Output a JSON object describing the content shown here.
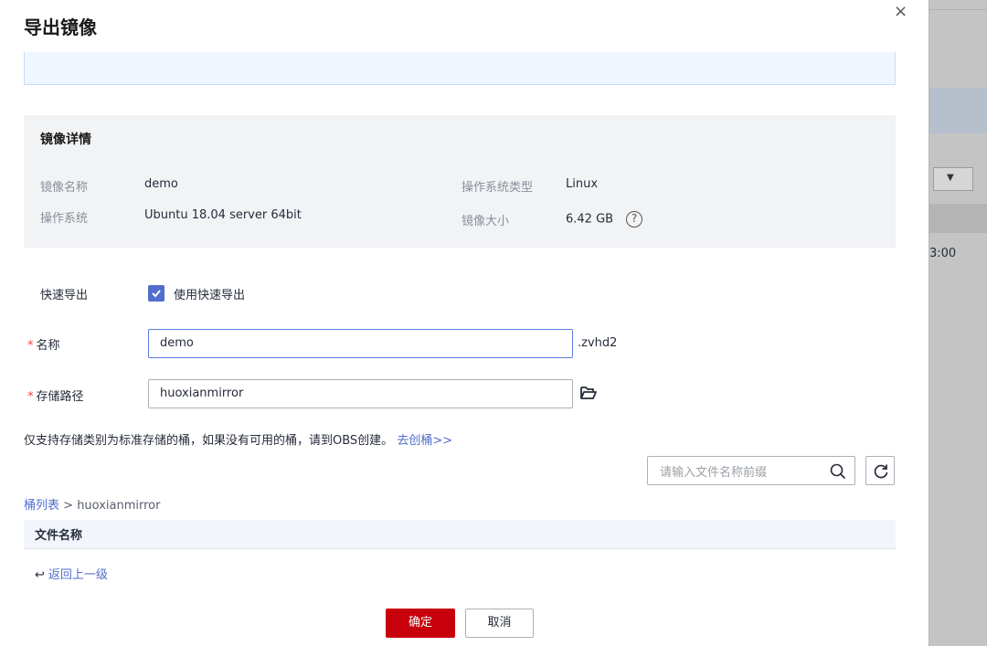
{
  "dialog": {
    "title": "导出镜像",
    "close_label": "×"
  },
  "details": {
    "heading": "镜像详情",
    "name_label": "镜像名称",
    "name_value": "demo",
    "os_type_label": "操作系统类型",
    "os_type_value": "Linux",
    "os_label": "操作系统",
    "os_value": "Ubuntu 18.04 server 64bit",
    "size_label": "镜像大小",
    "size_value": "6.42 GB",
    "help_glyph": "?"
  },
  "form": {
    "fast_export_label": "快速导出",
    "fast_export_checkbox_label": "使用快速导出",
    "fast_export_checked": true,
    "name_label": "名称",
    "name_value": "demo",
    "name_suffix": ".zvhd2",
    "path_label": "存储路径",
    "path_value": "huoxianmirror",
    "required_mark": "*"
  },
  "hint": {
    "text": "仅支持存储类别为标准存储的桶，如果没有可用的桶，请到OBS创建。",
    "link": "去创桶>>"
  },
  "search": {
    "placeholder": "请输入文件名称前缀"
  },
  "breadcrumb": {
    "root": "桶列表",
    "separator": " > ",
    "current": "huoxianmirror"
  },
  "table": {
    "columns": [
      "文件名称"
    ]
  },
  "back": {
    "arrow": "↩",
    "label": "返回上一级"
  },
  "buttons": {
    "confirm": "确定",
    "cancel": "取消"
  },
  "background": {
    "time_fragment": "3:00",
    "select_arrow": "▼"
  },
  "colors": {
    "primary_button": "#c7000b",
    "link": "#526ecc",
    "checkbox": "#526ecc",
    "required": "#e54545"
  }
}
